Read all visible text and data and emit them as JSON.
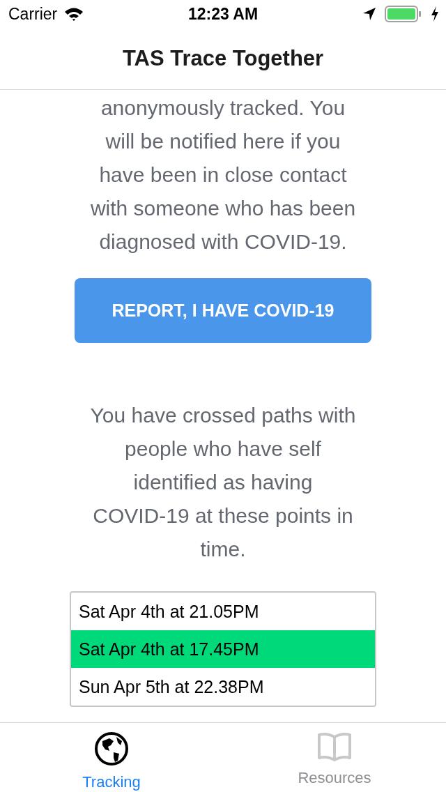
{
  "status_bar": {
    "carrier": "Carrier",
    "time": "12:23 AM"
  },
  "nav_bar": {
    "title": "TAS Trace Together"
  },
  "intro_text": "anonymously tracked. You\nwill be notified here if you\nhave been in close contact\nwith someone who has been\ndiagnosed with COVID-19.",
  "report_button": {
    "label": "REPORT, I HAVE COVID-19"
  },
  "crossed_text": "You have crossed paths with\npeople who have self\nidentified as having\nCOVID-19 at these points in\ntime.",
  "contacts": [
    {
      "label": "Sat Apr 4th at 21.05PM",
      "selected": false
    },
    {
      "label": "Sat Apr 4th at 17.45PM",
      "selected": true
    },
    {
      "label": "Sun Apr 5th at 22.38PM",
      "selected": false
    }
  ],
  "tabs": [
    {
      "label": "Tracking",
      "kind": "globe",
      "selected": true
    },
    {
      "label": "Resources",
      "kind": "book",
      "selected": false
    }
  ]
}
